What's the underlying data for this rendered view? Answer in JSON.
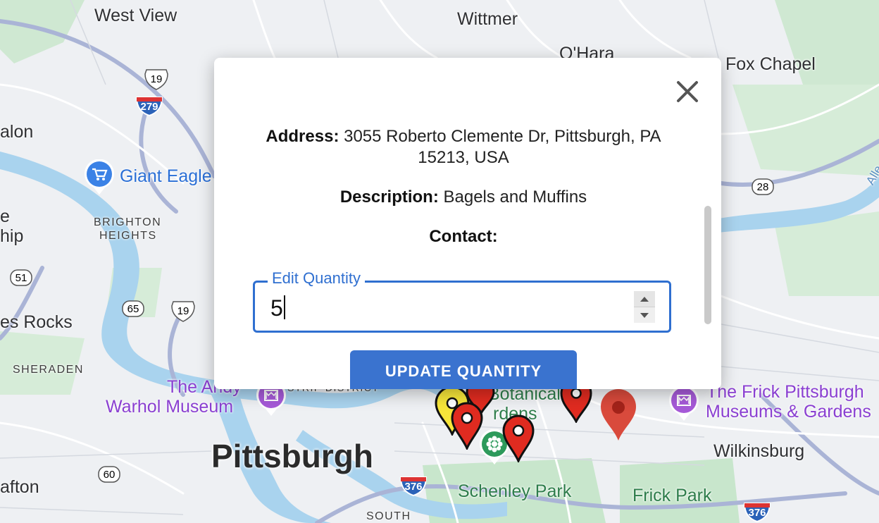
{
  "map": {
    "places": {
      "west_view": "West View",
      "wittmer": "Wittmer",
      "ohara": "O'Hara",
      "fox_chapel": "Fox Chapel",
      "avalon": "alon",
      "ship": "hip",
      "ship_e": "e",
      "rocks": "es Rocks",
      "wilkinsburg": "Wilkinsburg",
      "crafton": "afton",
      "pittsburgh": "Pittsburgh",
      "allegheny": "Alle"
    },
    "neighborhoods": {
      "brighton_1": "BRIGHTON",
      "brighton_2": "HEIGHTS",
      "sheraden": "SHERADEN",
      "strip": "STRIP DISTRICT",
      "south": "SOUTH"
    },
    "pois": {
      "giant_eagle": "Giant Eagle",
      "warhol_1": "The Andy",
      "warhol_2": "Warhol Museum",
      "frick_1": "The Frick Pittsburgh",
      "frick_2": "Museums & Gardens",
      "phipps_1": "Botanical",
      "phipps_2": "rdens",
      "schenley": "Schenley Park",
      "frick_park": "Frick Park"
    },
    "shields": {
      "us19a": "19",
      "i279": "279",
      "pa28": "28",
      "pa51": "51",
      "pa65": "65",
      "us19b": "19",
      "pa60": "60",
      "i376a": "376",
      "i376b": "376"
    }
  },
  "dialog": {
    "close_label": "Close",
    "address_label": "Address:",
    "address_value": "3055 Roberto Clemente Dr, Pittsburgh, PA 15213, USA",
    "description_label": "Description:",
    "description_value": "Bagels and Muffins",
    "contact_label": "Contact:",
    "contact_value": "",
    "quantity_label": "Edit Quantity",
    "quantity_value": "5",
    "update_button": "UPDATE QUANTITY"
  },
  "colors": {
    "accent": "#2f6fd0",
    "marker_red": "#e02b20",
    "marker_yellow": "#f7e63a",
    "google_pin": "#d94a3c",
    "water": "#a9d3ee",
    "park": "#c8e6cc"
  }
}
